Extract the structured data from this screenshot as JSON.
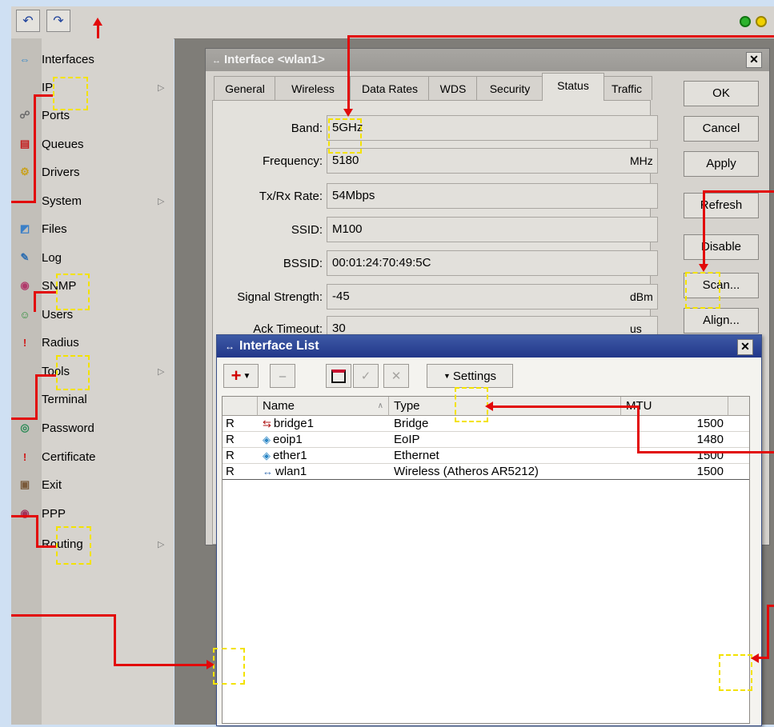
{
  "toolbar": {
    "undo_icon": "undo-icon",
    "redo_icon": "redo-icon",
    "status_colors": [
      "#2db32d",
      "#f0d000"
    ]
  },
  "sidebar": {
    "items": [
      {
        "label": "Interfaces",
        "icon": "interfaces-icon",
        "color": "#2c84c8",
        "submenu": false
      },
      {
        "label": "IP",
        "icon": "",
        "color": "",
        "submenu": true
      },
      {
        "label": "Ports",
        "icon": "ports-icon",
        "color": "#6a6a6a",
        "submenu": false
      },
      {
        "label": "Queues",
        "icon": "queues-icon",
        "color": "#c41a1a",
        "submenu": false
      },
      {
        "label": "Drivers",
        "icon": "drivers-icon",
        "color": "#c9a11c",
        "submenu": false
      },
      {
        "label": "System",
        "icon": "",
        "color": "",
        "submenu": true
      },
      {
        "label": "Files",
        "icon": "files-icon",
        "color": "#3a7fc7",
        "submenu": false
      },
      {
        "label": "Log",
        "icon": "log-icon",
        "color": "#2f6fb1",
        "submenu": false
      },
      {
        "label": "SNMP",
        "icon": "snmp-icon",
        "color": "#b03a6b",
        "submenu": false
      },
      {
        "label": "Users",
        "icon": "users-icon",
        "color": "#2e8f3a",
        "submenu": false
      },
      {
        "label": "Radius",
        "icon": "radius-icon",
        "color": "#d01515",
        "submenu": false
      },
      {
        "label": "Tools",
        "icon": "",
        "color": "",
        "submenu": true
      },
      {
        "label": "Terminal",
        "icon": "",
        "color": "",
        "submenu": false
      },
      {
        "label": "Password",
        "icon": "password-icon",
        "color": "#2a8a55",
        "submenu": false
      },
      {
        "label": "Certificate",
        "icon": "certificate-icon",
        "color": "#d01515",
        "submenu": false
      },
      {
        "label": "Exit",
        "icon": "exit-icon",
        "color": "#7a5a3a",
        "submenu": false
      },
      {
        "label": "PPP",
        "icon": "ppp-icon",
        "color": "#a2325a",
        "submenu": false
      },
      {
        "label": "Routing",
        "icon": "",
        "color": "",
        "submenu": true
      }
    ]
  },
  "interface_window": {
    "title": "Interface <wlan1>",
    "tabs": [
      "General",
      "Wireless",
      "Data Rates",
      "WDS",
      "Security",
      "Status",
      "Traffic"
    ],
    "active_tab": "Status",
    "fields": [
      {
        "label": "Band:",
        "value": "5GHz",
        "unit": ""
      },
      {
        "label": "Frequency:",
        "value": "5180",
        "unit": "MHz"
      },
      {
        "label": "Tx/Rx Rate:",
        "value": "54Mbps",
        "unit": ""
      },
      {
        "label": "SSID:",
        "value": "M100",
        "unit": ""
      },
      {
        "label": "BSSID:",
        "value": "00:01:24:70:49:5C",
        "unit": ""
      },
      {
        "label": "Signal Strength:",
        "value": "-45",
        "unit": "dBm"
      },
      {
        "label": "Ack Timeout:",
        "value": "30",
        "unit": "us"
      }
    ],
    "buttons": [
      "OK",
      "Cancel",
      "Apply",
      "Refresh",
      "Disable",
      "Scan...",
      "Align..."
    ]
  },
  "interface_list": {
    "title": "Interface List",
    "toolbar": {
      "settings_label": "Settings"
    },
    "columns": [
      "",
      "Name",
      "Type",
      "MTU"
    ],
    "rows": [
      {
        "flag": "R",
        "name": "bridge1",
        "type": "Bridge",
        "mtu": "1500",
        "icon": "bridge-icon"
      },
      {
        "flag": "R",
        "name": "eoip1",
        "type": "EoIP",
        "mtu": "1480",
        "icon": "eoip-icon"
      },
      {
        "flag": "R",
        "name": "ether1",
        "type": "Ethernet",
        "mtu": "1500",
        "icon": "ethernet-icon"
      },
      {
        "flag": "R",
        "name": "wlan1",
        "type": "Wireless (Atheros AR5212)",
        "mtu": "1500",
        "icon": "wireless-icon"
      }
    ]
  },
  "colors": {
    "annotation_red": "#e20a0a",
    "annotation_yellow": "#f3e200",
    "list_title": "#22378a"
  }
}
